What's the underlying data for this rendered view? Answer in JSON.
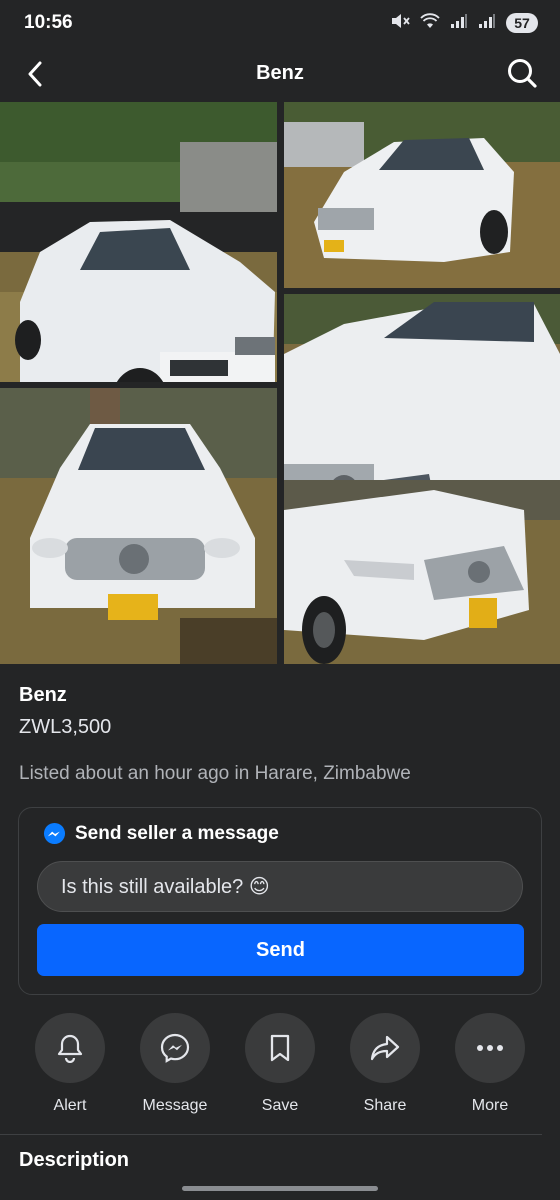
{
  "status": {
    "time": "10:56",
    "battery": "57"
  },
  "nav": {
    "title": "Benz"
  },
  "photos": [
    {
      "label": "car-photo-front-left"
    },
    {
      "label": "car-photo-front-right-far"
    },
    {
      "label": "car-photo-front-right-close"
    },
    {
      "label": "car-photo-front"
    },
    {
      "label": "car-photo-front-right-low"
    }
  ],
  "listing": {
    "title": "Benz",
    "price": "ZWL3,500",
    "meta": "Listed about an hour ago in Harare, Zimbabwe"
  },
  "message": {
    "heading": "Send seller a message",
    "input_value": "Is this still available? 😊",
    "send_label": "Send"
  },
  "actions": [
    {
      "label": "Alert",
      "icon": "bell-icon"
    },
    {
      "label": "Message",
      "icon": "messenger-icon"
    },
    {
      "label": "Save",
      "icon": "bookmark-icon"
    },
    {
      "label": "Share",
      "icon": "share-icon"
    },
    {
      "label": "More",
      "icon": "more-icon"
    }
  ],
  "description_heading": "Description",
  "colors": {
    "background": "#242526",
    "accent": "#0866ff",
    "surface": "#3a3b3c"
  }
}
